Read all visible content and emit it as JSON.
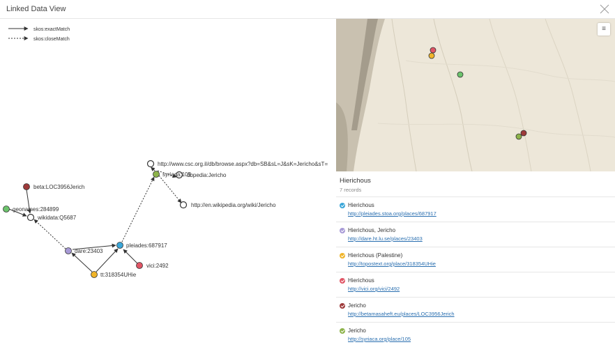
{
  "window": {
    "title": "Linked Data View"
  },
  "legend": [
    {
      "label": "skos:exactMatch"
    },
    {
      "label": "skos:closeMatch"
    }
  ],
  "graph": {
    "nodes": {
      "csc": {
        "label": "http://www.csc.org.il/db/browse.aspx?db=SB&sL=J&sK=Jericho&sT="
      },
      "dbpedia": {
        "label": "dbpedia:Jericho"
      },
      "syriaca": {
        "label": "syriaca:105",
        "color": "#8db34a"
      },
      "wikipedia": {
        "label": "http://en.wikipedia.org/wiki/Jericho"
      },
      "beta": {
        "label": "beta:LOC3956Jerich",
        "color": "#9e3a3a"
      },
      "geonames": {
        "label": "geonames:284899",
        "color": "#6cc36c"
      },
      "wikidata": {
        "label": "wikidata:Q5687"
      },
      "dare": {
        "label": "dare:23403",
        "color": "#a79ad6"
      },
      "pleiades": {
        "label": "pleiades:687917",
        "color": "#3aa6d8"
      },
      "vici": {
        "label": "vici:2492",
        "color": "#e05565"
      },
      "tt": {
        "label": "tt:318354UHie",
        "color": "#f0b429"
      }
    }
  },
  "map": {
    "menu_icon": "hamburger-icon",
    "markers": [
      {
        "name": "vici",
        "color": "#e05565"
      },
      {
        "name": "tt",
        "color": "#f0b429"
      },
      {
        "name": "geonames",
        "color": "#6cc36c"
      },
      {
        "name": "beta",
        "color": "#9e3a3a"
      },
      {
        "name": "syriaca",
        "color": "#8db34a"
      }
    ]
  },
  "panel": {
    "title": "Hierichous",
    "count": "7 records",
    "records": [
      {
        "title": "Hierichous",
        "link": "http://pleiades.stoa.org/places/687917",
        "color": "#3aa6d8"
      },
      {
        "title": "Hierichous, Jericho",
        "link": "http://dare.ht.lu.se/places/23403",
        "color": "#a79ad6"
      },
      {
        "title": "Hierichous (Palestine)",
        "link": "http://topostext.org/place/318354UHie",
        "color": "#f0b429"
      },
      {
        "title": "Hierichous",
        "link": "http://vici.org/vici/2492",
        "color": "#e05565"
      },
      {
        "title": "Jericho",
        "link": "http://betamasaheft.eu/places/LOC3956Jerich",
        "color": "#9e3a3a"
      },
      {
        "title": "Jericho",
        "link": "http://syriaca.org/place/105",
        "color": "#8db34a"
      }
    ]
  }
}
